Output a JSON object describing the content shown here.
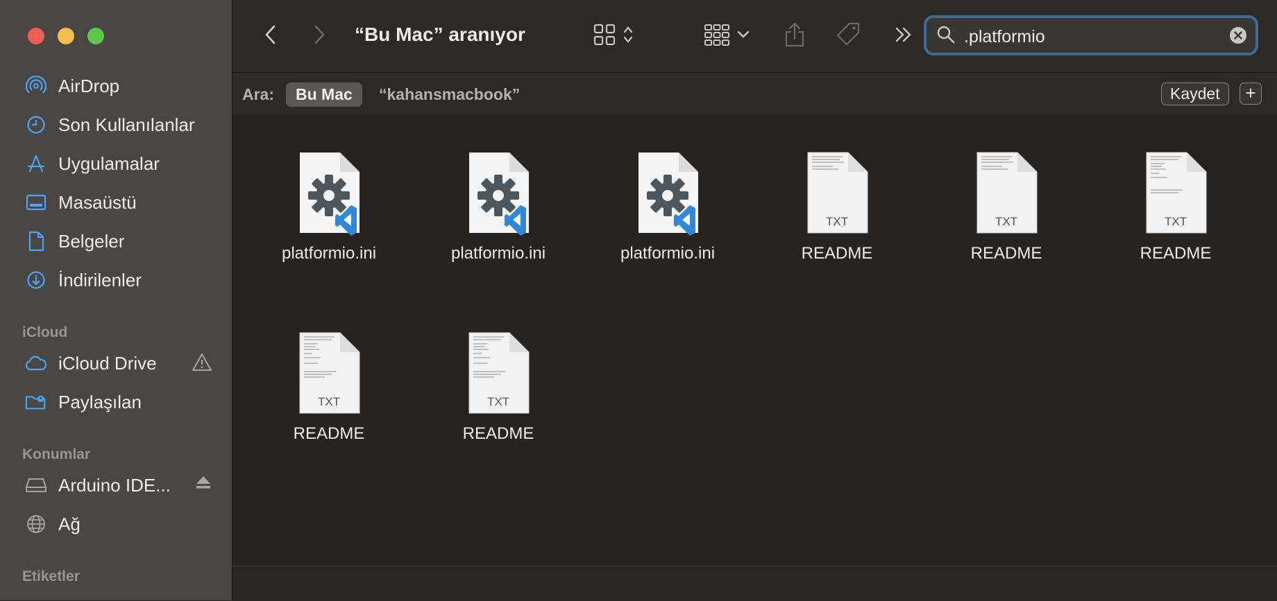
{
  "window": {
    "title": "“Bu Mac” aranıyor"
  },
  "sidebar": {
    "favorites": [
      {
        "label": "AirDrop",
        "icon": "airdrop-icon"
      },
      {
        "label": "Son Kullanılanlar",
        "icon": "clock-icon"
      },
      {
        "label": "Uygulamalar",
        "icon": "applications-icon"
      },
      {
        "label": "Masaüstü",
        "icon": "desktop-icon"
      },
      {
        "label": "Belgeler",
        "icon": "document-icon"
      },
      {
        "label": "İndirilenler",
        "icon": "download-icon"
      }
    ],
    "icloud_header": "iCloud",
    "icloud": [
      {
        "label": "iCloud Drive",
        "icon": "cloud-icon",
        "trail_icon": "warning-icon"
      },
      {
        "label": "Paylaşılan",
        "icon": "shared-folder-icon"
      }
    ],
    "locations_header": "Konumlar",
    "locations": [
      {
        "label": "Arduino IDE...",
        "icon": "disk-icon",
        "trail_icon": "eject-icon"
      },
      {
        "label": "Ağ",
        "icon": "network-icon"
      }
    ],
    "tags_header": "Etiketler"
  },
  "search": {
    "value": ".platformio"
  },
  "scope": {
    "label": "Ara:",
    "selected": "Bu Mac",
    "alternate": "“kahansmacbook”",
    "save_label": "Kaydet",
    "add_label": "+"
  },
  "files": [
    {
      "name": "platformio.ini",
      "kind": "vscode-config"
    },
    {
      "name": "platformio.ini",
      "kind": "vscode-config"
    },
    {
      "name": "platformio.ini",
      "kind": "vscode-config"
    },
    {
      "name": "README",
      "kind": "txt",
      "badge": "TXT"
    },
    {
      "name": "README",
      "kind": "txt",
      "badge": "TXT"
    },
    {
      "name": "README",
      "kind": "txt",
      "badge": "TXT"
    },
    {
      "name": "README",
      "kind": "txt",
      "badge": "TXT"
    },
    {
      "name": "README",
      "kind": "txt",
      "badge": "TXT"
    }
  ],
  "colors": {
    "accent": "#3d6b94",
    "sidebar_icon": "#4aa3f5"
  }
}
